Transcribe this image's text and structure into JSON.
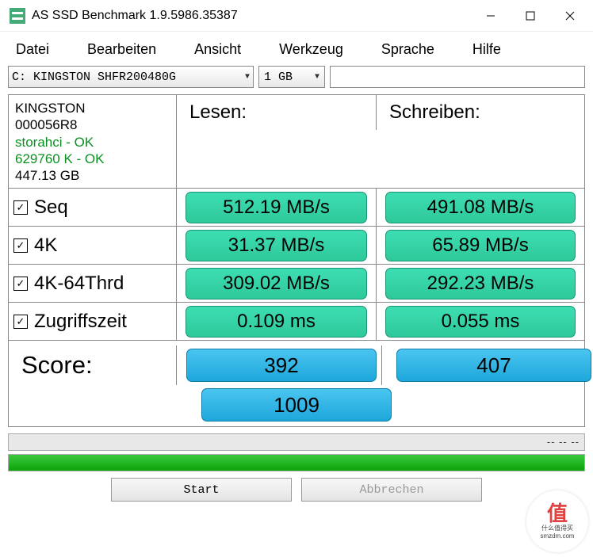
{
  "window": {
    "title": "AS SSD Benchmark 1.9.5986.35387"
  },
  "menu": {
    "file": "Datei",
    "edit": "Bearbeiten",
    "view": "Ansicht",
    "tools": "Werkzeug",
    "language": "Sprache",
    "help": "Hilfe"
  },
  "selectors": {
    "drive": "C: KINGSTON SHFR200480G",
    "size": "1 GB"
  },
  "info": {
    "model": "KINGSTON",
    "fw": "000056R8",
    "driver": "storahci - OK",
    "align": "629760 K - OK",
    "capacity": "447.13 GB"
  },
  "headers": {
    "read": "Lesen:",
    "write": "Schreiben:"
  },
  "rows": {
    "seq": {
      "label": "Seq",
      "read": "512.19 MB/s",
      "write": "491.08 MB/s"
    },
    "k4": {
      "label": "4K",
      "read": "31.37 MB/s",
      "write": "65.89 MB/s"
    },
    "k4t": {
      "label": "4K-64Thrd",
      "read": "309.02 MB/s",
      "write": "292.23 MB/s"
    },
    "acc": {
      "label": "Zugriffszeit",
      "read": "0.109 ms",
      "write": "0.055 ms"
    }
  },
  "score": {
    "label": "Score:",
    "read": "392",
    "write": "407",
    "total": "1009"
  },
  "progress": {
    "dashes": "-- -- --"
  },
  "buttons": {
    "start": "Start",
    "abort": "Abbrechen"
  },
  "watermark": {
    "big": "值",
    "line1": "什么值得买",
    "line2": "smzdm.com"
  }
}
